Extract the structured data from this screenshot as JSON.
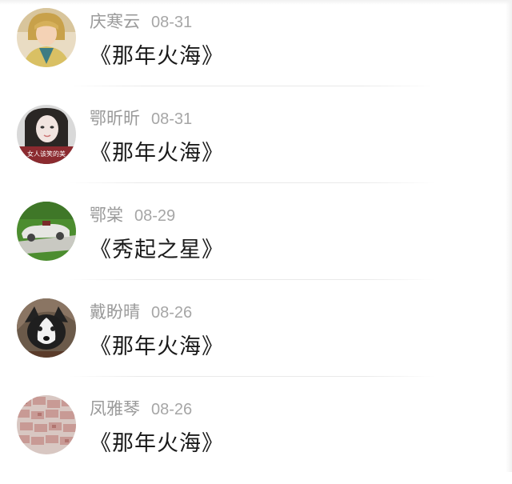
{
  "comments": [
    {
      "name": "庆寒云",
      "date": "08-31",
      "title": "《那年火海》",
      "avatar": "woman-portrait-avatar"
    },
    {
      "name": "鄂昕昕",
      "date": "08-31",
      "title": "《那年火海》",
      "avatar": "girl-selfie-avatar"
    },
    {
      "name": "鄂棠",
      "date": "08-29",
      "title": "《秀起之星》",
      "avatar": "vintage-car-avatar"
    },
    {
      "name": "戴盼晴",
      "date": "08-26",
      "title": "《那年火海》",
      "avatar": "husky-dog-avatar"
    },
    {
      "name": "凤雅琴",
      "date": "08-26",
      "title": "《那年火海》",
      "avatar": "money-stack-avatar"
    }
  ],
  "colors": {
    "name": "#9a9a9a",
    "date": "#a6a6a6",
    "title": "#1a1a1a",
    "divider": "#e9e9e9"
  }
}
